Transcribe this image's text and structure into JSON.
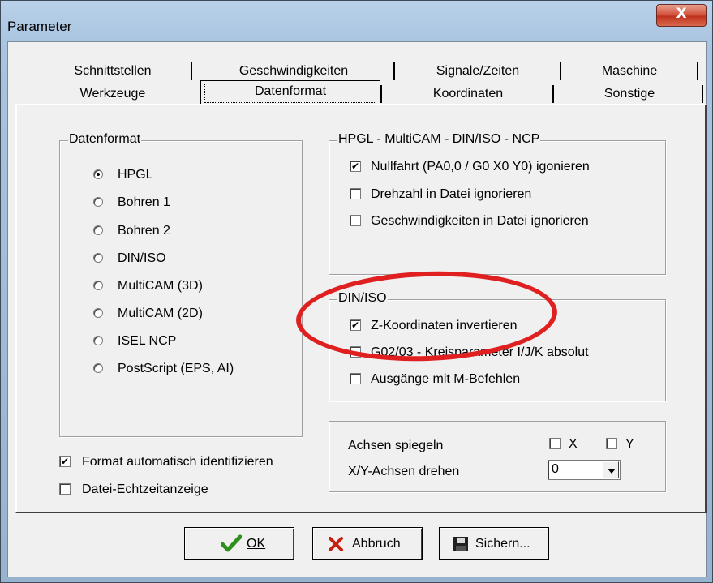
{
  "window": {
    "title": "Parameter",
    "close_glyph": "X"
  },
  "tabs_row1": [
    "Schnittstellen",
    "Geschwindigkeiten",
    "Signale/Zeiten",
    "Maschine"
  ],
  "tabs_row2": [
    "Werkzeuge",
    "Datenformat",
    "Koordinaten",
    "Sonstige"
  ],
  "selected_tab": "Datenformat",
  "datenformat": {
    "label": "Datenformat",
    "options": [
      "HPGL",
      "Bohren 1",
      "Bohren 2",
      "DIN/ISO",
      "MultiCAM (3D)",
      "MultiCAM (2D)",
      "ISEL NCP",
      "PostScript (EPS, AI)"
    ],
    "selected": "HPGL"
  },
  "hpgl_group": {
    "label": "HPGL - MultiCAM - DIN/ISO - NCP",
    "items": [
      {
        "label": "Nullfahrt (PA0,0 / G0 X0 Y0) igonieren",
        "checked": true
      },
      {
        "label": "Drehzahl in Datei ignorieren",
        "checked": false
      },
      {
        "label": "Geschwindigkeiten in Datei ignorieren",
        "checked": false
      }
    ]
  },
  "diniso_group": {
    "label": "DIN/ISO",
    "items": [
      {
        "label": "Z-Koordinaten invertieren",
        "checked": true
      },
      {
        "label": "G02/03 - Kreisparameter I/J/K absolut",
        "checked": false
      },
      {
        "label": "Ausgänge mit M-Befehlen",
        "checked": false
      }
    ]
  },
  "axes": {
    "mirror_label": "Achsen spiegeln",
    "mirror_x": "X",
    "mirror_y": "Y",
    "rotate_label": "X/Y-Achsen drehen",
    "rotate_value": "0"
  },
  "bottom_checks": [
    {
      "label": "Format automatisch identifizieren",
      "checked": true
    },
    {
      "label": "Datei-Echtzeitanzeige",
      "checked": false
    }
  ],
  "buttons": {
    "ok_label": "OK",
    "cancel_label": "Abbruch",
    "save_label": "Sichern..."
  },
  "annotation": {
    "color": "#e02020"
  },
  "check_glyph": "✔"
}
